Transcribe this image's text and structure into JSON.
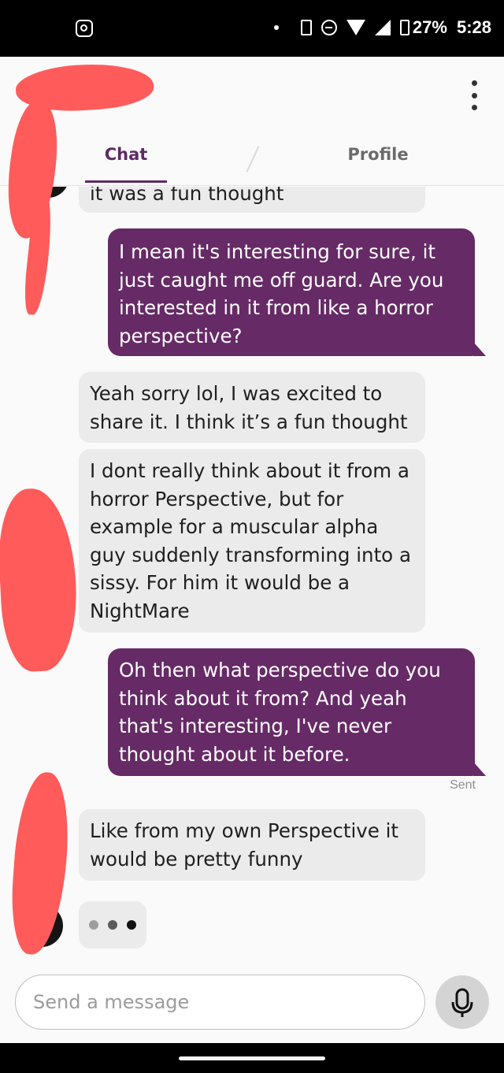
{
  "status_bar": {
    "battery": "27%",
    "time": "5:28"
  },
  "tabs": [
    {
      "label": "Chat",
      "active": true
    },
    {
      "label": "Profile",
      "active": false
    }
  ],
  "messages": [
    {
      "side": "in",
      "text": "it was a fun thought"
    },
    {
      "side": "out",
      "text": "I mean it's interesting for sure, it just caught me off guard. Are you interested in it from like a horror perspective?"
    },
    {
      "side": "in",
      "text": "Yeah sorry lol, I was excited to share it. I think it’s a fun thought"
    },
    {
      "side": "in",
      "text": "I dont really think about it from a horror Perspective, but for example for a muscular alpha guy suddenly transforming into a sissy. For him it would be a NightMare"
    },
    {
      "side": "out",
      "text": "Oh then what perspective do you think about it from? And yeah that's interesting, I've never thought about it before."
    },
    {
      "side": "in",
      "text": "Like from my own Perspective it would be pretty funny"
    }
  ],
  "sent_status": "Sent",
  "typing_indicator": {
    "dots": 3,
    "dot_colors": [
      "#9e9e9e",
      "#5a5a5a",
      "#111111"
    ]
  },
  "composer": {
    "placeholder": "Send a message"
  },
  "colors": {
    "accent": "#662a66",
    "incoming_bubble": "#ebebeb",
    "redaction": "#ff5b5b"
  },
  "icons": {
    "back": "back-arrow-icon",
    "menu": "more-vertical-icon",
    "mic": "microphone-icon",
    "status": [
      "instagram-notification-icon",
      "vibrate-icon",
      "do-not-disturb-icon",
      "wifi-icon",
      "signal-icon",
      "battery-icon"
    ]
  }
}
